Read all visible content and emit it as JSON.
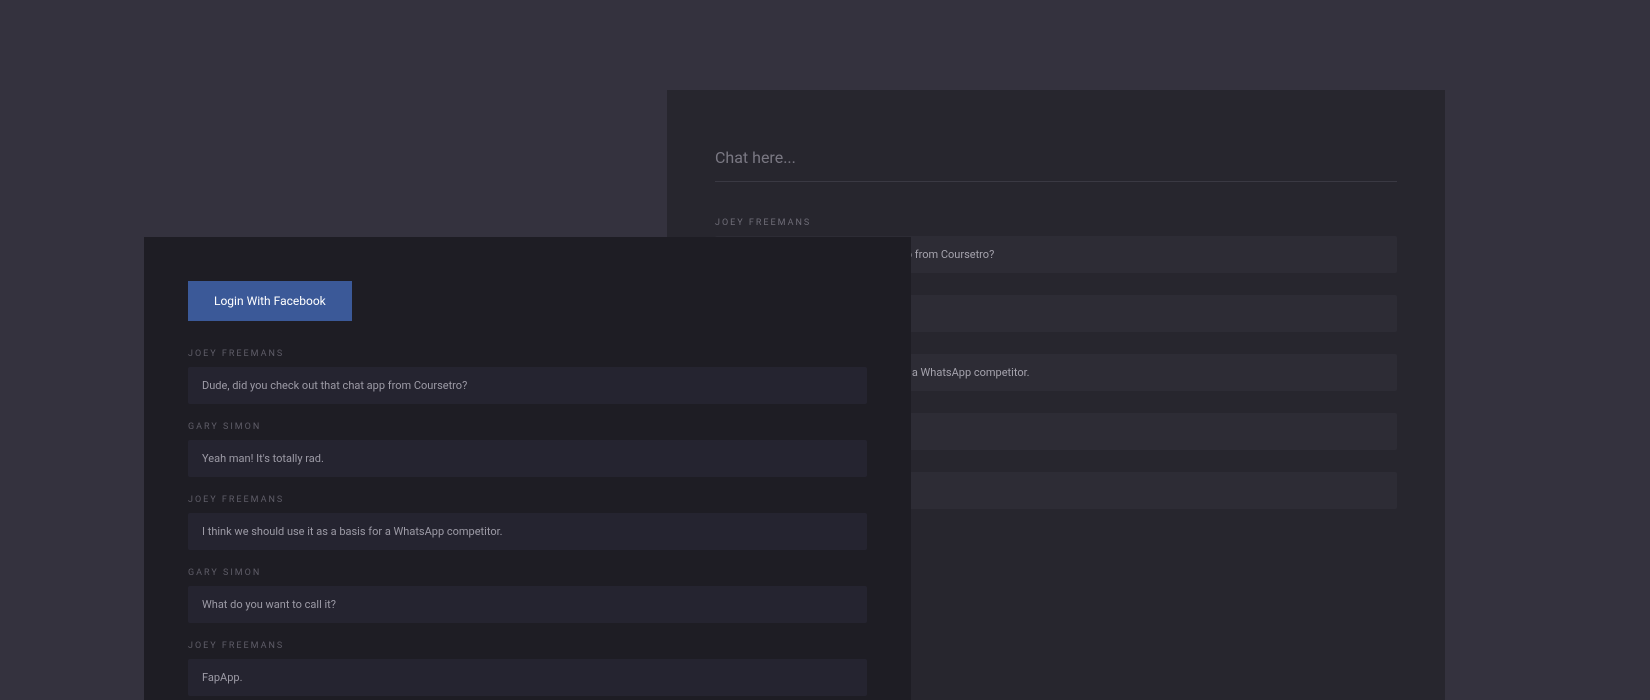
{
  "back": {
    "chat_placeholder": "Chat here...",
    "messages": [
      {
        "author": "JOEY FREEMANS",
        "text": "Dude, did you check out that chat app from Coursetro?"
      },
      {
        "author": "",
        "text": ""
      },
      {
        "author": "",
        "text": "I think we should use it as a basis for a WhatsApp competitor."
      },
      {
        "author": "",
        "text": ""
      },
      {
        "author": "",
        "text": ""
      }
    ]
  },
  "front": {
    "login_label": "Login With Facebook",
    "messages": [
      {
        "author": "JOEY FREEMANS",
        "text": "Dude, did you check out that chat app from Coursetro?"
      },
      {
        "author": "GARY SIMON",
        "text": "Yeah man! It's totally rad."
      },
      {
        "author": "JOEY FREEMANS",
        "text": "I think we should use it as a basis for a WhatsApp competitor."
      },
      {
        "author": "GARY SIMON",
        "text": "What do you want to call it?"
      },
      {
        "author": "JOEY FREEMANS",
        "text": "FapApp."
      }
    ]
  }
}
